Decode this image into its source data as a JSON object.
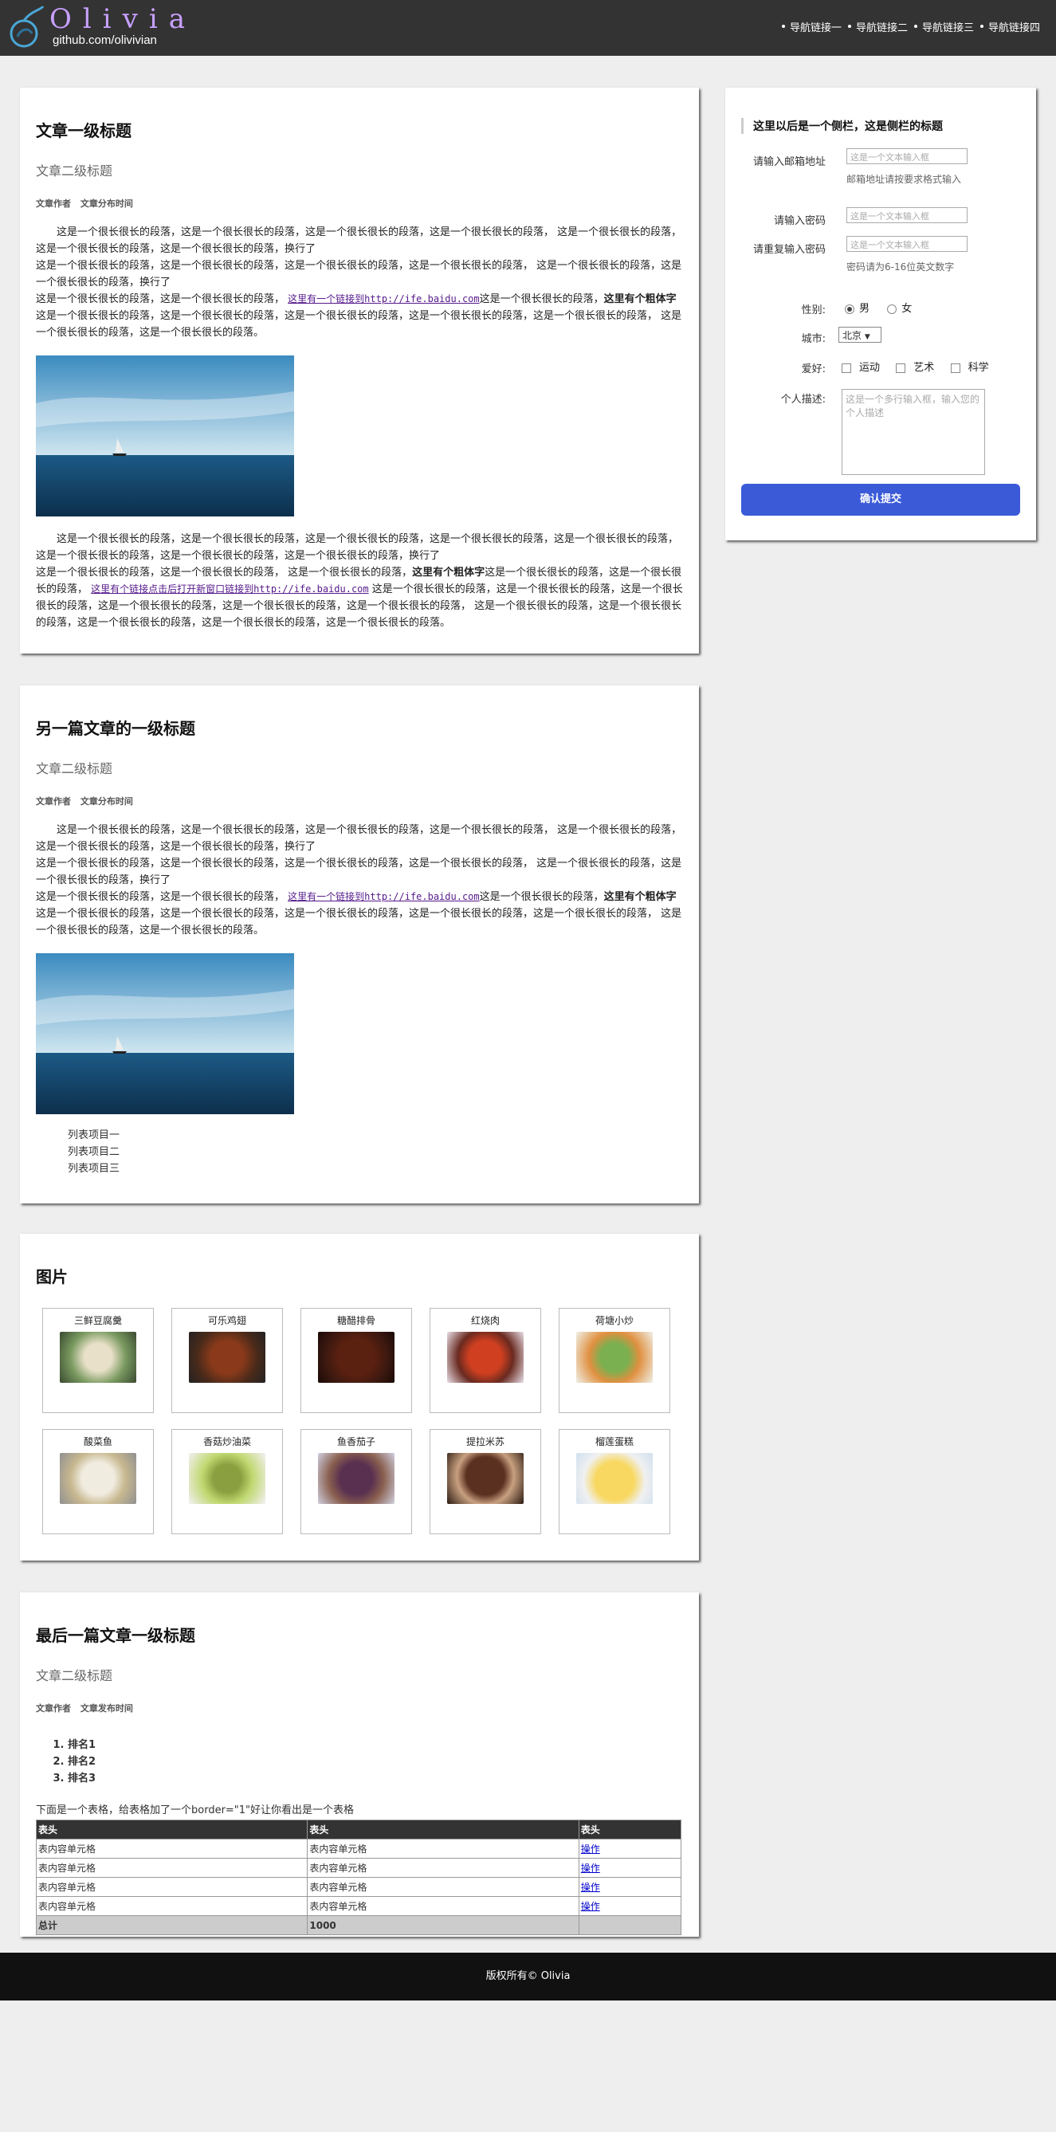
{
  "header": {
    "logo_text": "Olivia",
    "logo_sub": "github.com/olivivian",
    "nav": [
      "导航链接一",
      "导航链接二",
      "导航链接三",
      "导航链接四"
    ]
  },
  "article1": {
    "title": "文章一级标题",
    "subtitle": "文章二级标题",
    "author": "文章作者",
    "time": "文章分布时间",
    "p1_a": "这是一个很长很长的段落，这是一个很长很长的段落，这是一个很长很长的段落，这是一个很长很长的段落，   这是一个很长很长的段落，这是一个很长很长的段落，这是一个很长很长的段落，换行了",
    "p1_b": "这是一个很长很长的段落，这是一个很长很长的段落，这是一个很长很长的段落，这是一个很长很长的段落，   这是一个很长很长的段落，这是一个很长很长的段落，换行了",
    "p1_c1": "这是一个很长很长的段落，这是一个很长很长的段落，  ",
    "p1_link": "这里有一个链接到http://ife.baidu.com",
    "p1_c2": "这是一个很长很长的段落，",
    "p1_bold": "这里有个粗体字",
    "p1_c3": " 这是一个很长很长的段落，这是一个很长很长的段落，这是一个很长很长的段落，这是一个很长很长的段落，这是一个很长很长的段落，   这是一个很长很长的段落，这是一个很长很长的段落。",
    "p2_a": "这是一个很长很长的段落，这是一个很长很长的段落，这是一个很长很长的段落，这是一个很长很长的段落，这是一个很长很长的段落，   这是一个很长很长的段落，这是一个很长很长的段落，这是一个很长很长的段落，换行了",
    "p2_b1": "这是一个很长很长的段落，这是一个很长很长的段落，   这是一个很长很长的段落，",
    "p2_bold": "这里有个粗体字",
    "p2_b2": "这是一个很长很长的段落，这是一个很长很长的段落，   ",
    "p2_link": "这里有个链接点击后打开新窗口链接到http://ife.baidu.com",
    "p2_b3": " 这是一个很长很长的段落，这是一个很长很长的段落，这是一个很长很长的段落，这是一个很长很长的段落，这是一个很长很长的段落，这是一个很长很长的段落，   这是一个很长很长的段落，这是一个很长很长的段落，这是一个很长很长的段落，这是一个很长很长的段落，这是一个很长很长的段落。"
  },
  "article2": {
    "title": "另一篇文章的一级标题",
    "subtitle": "文章二级标题",
    "author": "文章作者",
    "time": "文章分布时间",
    "p1_a": "这是一个很长很长的段落，这是一个很长很长的段落，这是一个很长很长的段落，这是一个很长很长的段落，   这是一个很长很长的段落，这是一个很长很长的段落，这是一个很长很长的段落，换行了",
    "p1_b": "这是一个很长很长的段落，这是一个很长很长的段落，这是一个很长很长的段落，这是一个很长很长的段落，   这是一个很长很长的段落，这是一个很长很长的段落，换行了",
    "p1_c1": "这是一个很长很长的段落，这是一个很长很长的段落，  ",
    "p1_link": "这里有一个链接到http://ife.baidu.com",
    "p1_c2": "这是一个很长很长的段落，",
    "p1_bold": "这里有个粗体字",
    "p1_c3": " 这是一个很长很长的段落，这是一个很长很长的段落，这是一个很长很长的段落，这是一个很长很长的段落，这是一个很长很长的段落，   这是一个很长很长的段落，这是一个很长很长的段落。",
    "list": [
      "列表项目一",
      "列表项目二",
      "列表项目三"
    ]
  },
  "gallery": {
    "title": "图片",
    "items": [
      "三鲜豆腐羹",
      "可乐鸡翅",
      "糖醋排骨",
      "红烧肉",
      "荷塘小炒",
      "酸菜鱼",
      "香菇炒油菜",
      "鱼香茄子",
      "提拉米苏",
      "榴莲蛋糕"
    ]
  },
  "article3": {
    "title": "最后一篇文章一级标题",
    "subtitle": "文章二级标题",
    "author": "文章作者",
    "time": "文章发布时间",
    "ranks": [
      "排名1",
      "排名2",
      "排名3"
    ],
    "table_note": "下面是一个表格，给表格加了一个border=\"1\"好让你看出是一个表格",
    "table": {
      "headers": [
        "表头",
        "表头",
        "表头"
      ],
      "rows": [
        [
          "表内容单元格",
          "表内容单元格",
          "操作"
        ],
        [
          "表内容单元格",
          "表内容单元格",
          "操作"
        ],
        [
          "表内容单元格",
          "表内容单元格",
          "操作"
        ],
        [
          "表内容单元格",
          "表内容单元格",
          "操作"
        ]
      ],
      "footer": [
        "总计",
        "1000",
        ""
      ]
    }
  },
  "sidebar": {
    "title": "这里以后是一个侧栏，这是侧栏的标题",
    "email_label": "请输入邮箱地址",
    "email_placeholder": "这是一个文本输入框",
    "email_hint": "邮箱地址请按要求格式输入",
    "pwd_label": "请输入密码",
    "pwd_placeholder": "这是一个文本输入框",
    "pwd2_label": "请重复输入密码",
    "pwd2_placeholder": "这是一个文本输入框",
    "pwd_hint": "密码请为6-16位英文数字",
    "gender_label": "性别:",
    "gender_male": "男",
    "gender_female": "女",
    "city_label": "城市:",
    "city_value": "北京",
    "hobby_label": "爱好:",
    "hobbies": [
      "运动",
      "艺术",
      "科学"
    ],
    "desc_label": "个人描述:",
    "desc_placeholder": "这是一个多行输入框，输入您的个人描述",
    "submit": "确认提交"
  },
  "footer": {
    "text": "版权所有© Olivia"
  },
  "colors": {
    "header_bg": "#333333",
    "logo_purple": "#c8a0ff",
    "submit_blue": "#3a5ad8",
    "footer_bg": "#111111"
  }
}
